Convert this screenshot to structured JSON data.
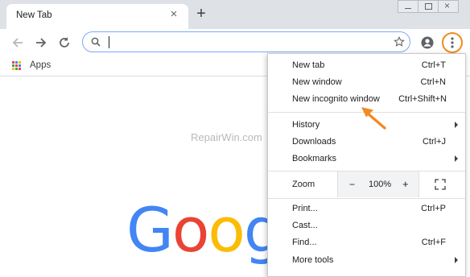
{
  "tab": {
    "title": "New Tab",
    "close_icon": "close-icon"
  },
  "toolbar": {
    "back_icon": "back-arrow-icon",
    "forward_icon": "forward-arrow-icon",
    "reload_icon": "reload-icon",
    "search_value": "",
    "star_icon": "bookmark-star-icon",
    "profile_icon": "profile-icon",
    "menu_icon": "three-dots-menu-icon"
  },
  "bookmarks_bar": {
    "apps_label": "Apps"
  },
  "watermark": "RepairWin.com",
  "logo_letters": [
    {
      "ch": "G",
      "color": "#4285f4"
    },
    {
      "ch": "o",
      "color": "#ea4335"
    },
    {
      "ch": "o",
      "color": "#fbbc05"
    },
    {
      "ch": "g",
      "color": "#4285f4"
    }
  ],
  "menu": {
    "new_tab": {
      "label": "New tab",
      "shortcut": "Ctrl+T"
    },
    "new_window": {
      "label": "New window",
      "shortcut": "Ctrl+N"
    },
    "new_incognito": {
      "label": "New incognito window",
      "shortcut": "Ctrl+Shift+N"
    },
    "history": {
      "label": "History"
    },
    "downloads": {
      "label": "Downloads",
      "shortcut": "Ctrl+J"
    },
    "bookmarks": {
      "label": "Bookmarks"
    },
    "zoom": {
      "label": "Zoom",
      "minus": "−",
      "value": "100%",
      "plus": "+"
    },
    "print": {
      "label": "Print...",
      "shortcut": "Ctrl+P"
    },
    "cast": {
      "label": "Cast..."
    },
    "find": {
      "label": "Find...",
      "shortcut": "Ctrl+F"
    },
    "more_tools": {
      "label": "More tools"
    }
  },
  "colors": {
    "highlight_orange": "#f08a24",
    "omnibox_focus_blue": "#7baaf7",
    "titlebar": "#dee1e6"
  }
}
